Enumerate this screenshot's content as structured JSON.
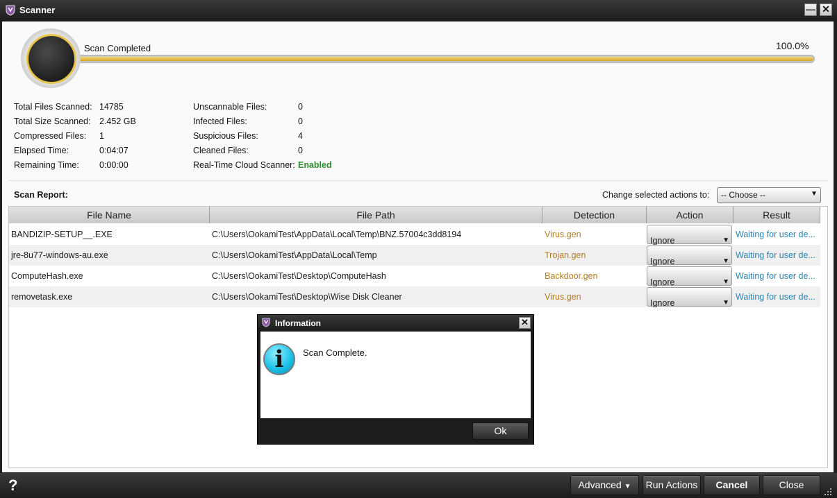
{
  "window": {
    "title": "Scanner",
    "minimize_label": "—",
    "close_label": "✕"
  },
  "scan": {
    "status": "Scan Completed",
    "progress_text": "100.0%",
    "progress": 1.0
  },
  "stats_left": [
    {
      "label": "Total Files Scanned:",
      "value": "14785"
    },
    {
      "label": "Total Size Scanned:",
      "value": "2.452 GB"
    },
    {
      "label": "Compressed Files:",
      "value": "1"
    },
    {
      "label": "Elapsed Time:",
      "value": "0:04:07"
    },
    {
      "label": "Remaining Time:",
      "value": "0:00:00"
    }
  ],
  "stats_right": [
    {
      "label": "Unscannable Files:",
      "value": "0"
    },
    {
      "label": "Infected Files:",
      "value": "0"
    },
    {
      "label": "Suspicious Files:",
      "value": "4"
    },
    {
      "label": "Cleaned Files:",
      "value": "0"
    },
    {
      "label": "Real-Time Cloud Scanner:",
      "value": "Enabled",
      "color": "#2c8b2c"
    }
  ],
  "report": {
    "title": "Scan Report:",
    "change_label": "Change selected actions to:",
    "choose_value": "-- Choose --",
    "columns": [
      "File Name",
      "File Path",
      "Detection",
      "Action",
      "Result"
    ],
    "rows": [
      {
        "name": "BANDIZIP-SETUP__.EXE",
        "path": "C:\\Users\\OokamiTest\\AppData\\Local\\Temp\\BNZ.57004c3dd8194",
        "detection": "Virus.gen",
        "action": "Ignore",
        "result": "Waiting for user de..."
      },
      {
        "name": "jre-8u77-windows-au.exe",
        "path": "C:\\Users\\OokamiTest\\AppData\\Local\\Temp",
        "detection": "Trojan.gen",
        "action": "Ignore",
        "result": "Waiting for user de..."
      },
      {
        "name": "ComputeHash.exe",
        "path": "C:\\Users\\OokamiTest\\Desktop\\ComputeHash",
        "detection": "Backdoor.gen",
        "action": "Ignore",
        "result": "Waiting for user de..."
      },
      {
        "name": "removetask.exe",
        "path": "C:\\Users\\OokamiTest\\Desktop\\Wise Disk Cleaner",
        "detection": "Virus.gen",
        "action": "Ignore",
        "result": "Waiting for user de..."
      }
    ]
  },
  "buttons": {
    "help": "?",
    "advanced": "Advanced",
    "run_actions": "Run Actions",
    "cancel": "Cancel",
    "close": "Close"
  },
  "dialog": {
    "title": "Information",
    "close_label": "✕",
    "icon_glyph": "i",
    "message": "Scan Complete.",
    "ok": "Ok"
  },
  "colors": {
    "accent": "#e8c44c",
    "detection": "#b17d1f",
    "result": "#2784b0",
    "enabled": "#2c8b2c"
  }
}
